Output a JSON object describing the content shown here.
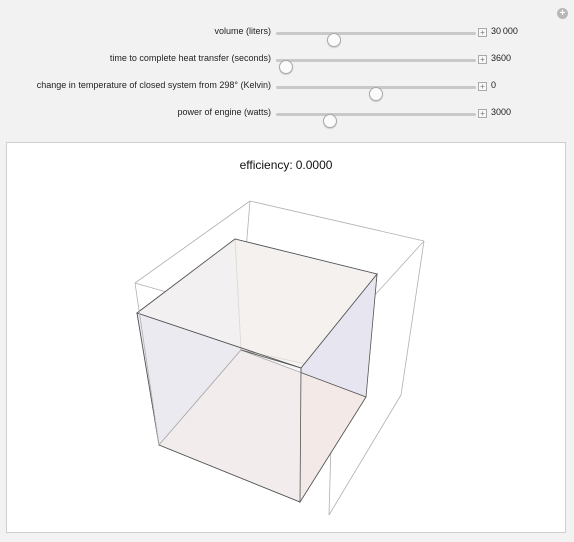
{
  "controls": [
    {
      "label": "volume (liters)",
      "value": "30 000",
      "level": 0.29
    },
    {
      "label": "time to complete heat transfer (seconds)",
      "value": "3600",
      "level": 0.05
    },
    {
      "label": "change in temperature of closed system from 298° (Kelvin)",
      "value": "0",
      "level": 0.5
    },
    {
      "label": "power of engine (watts)",
      "value": "3000",
      "level": 0.27
    }
  ],
  "display": {
    "efficiency_label": "efficiency:",
    "efficiency_value": "0.0000"
  },
  "colors": {
    "face_blue": "#e6e5f0",
    "face_pink": "#f3e9e6",
    "face_gray": "#f3f2f0",
    "edge": "#555555",
    "box_edge": "#b0b0b0"
  },
  "icons": {
    "corner": "plus-circle-icon",
    "stepper": "plus-square-icon"
  }
}
